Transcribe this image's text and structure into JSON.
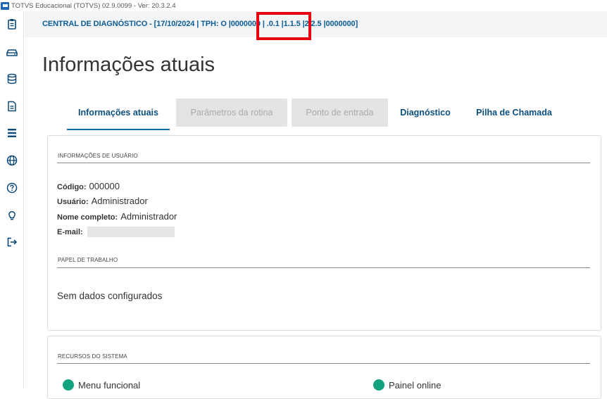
{
  "window": {
    "title": "TOTVS Educacional (TOTVS) 02.9.0099 - Ver: 20.3.2.4"
  },
  "sidebar": {
    "items": [
      {
        "name": "clipboard-icon"
      },
      {
        "name": "drive-icon"
      },
      {
        "name": "database-icon"
      },
      {
        "name": "document-icon"
      },
      {
        "name": "list-icon"
      },
      {
        "name": "globe-icon"
      },
      {
        "name": "help-icon"
      },
      {
        "name": "lightbulb-icon"
      },
      {
        "name": "logout-icon"
      }
    ]
  },
  "header": {
    "text": "CENTRAL DE DIAGNÓSTICO - [17/10/2024 | TPH: O  |0000000 | .0.1 |1.1.5 |2.2.5 |0000000]"
  },
  "page": {
    "title": "Informações atuais"
  },
  "tabs": [
    {
      "label": "Informações atuais",
      "state": "active"
    },
    {
      "label": "Parâmetros da rotina",
      "state": "disabled"
    },
    {
      "label": "Ponto de entrada",
      "state": "disabled"
    },
    {
      "label": "Diagnóstico",
      "state": "normal"
    },
    {
      "label": "Pilha de Chamada",
      "state": "normal"
    }
  ],
  "user_info": {
    "section_title": "INFORMAÇÕES DE USUÁRIO",
    "code_label": "Código:",
    "code_value": "000000",
    "user_label": "Usuário:",
    "user_value": "Administrador",
    "fullname_label": "Nome completo:",
    "fullname_value": "Administrador",
    "email_label": "E-mail:",
    "email_value": ""
  },
  "work_role": {
    "section_title": "PAPEL DE TRABALHO",
    "empty_message": "Sem dados configurados"
  },
  "system_resources": {
    "section_title": "RECURSOS DO SISTEMA",
    "items": [
      {
        "label": "Menu funcional",
        "status_color": "#14a37f"
      },
      {
        "label": "Painel online",
        "status_color": "#14a37f"
      }
    ]
  },
  "colors": {
    "accent": "#0b5c96",
    "highlight": "#e8000e",
    "status_ok": "#14a37f"
  }
}
